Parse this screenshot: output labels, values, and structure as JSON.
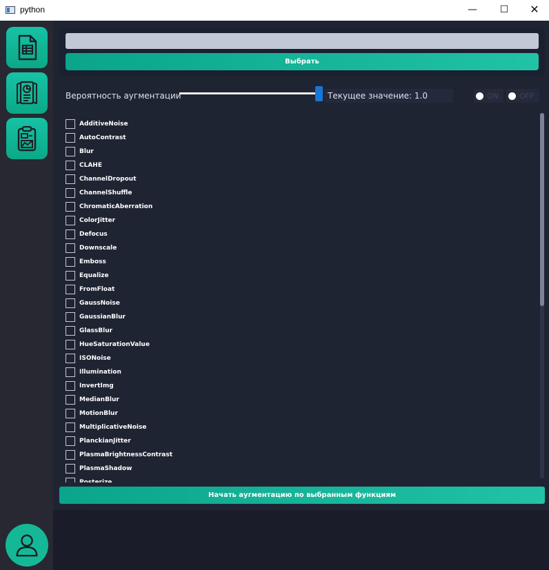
{
  "window": {
    "title": "python",
    "minimize_glyph": "—",
    "maximize_glyph": "☐",
    "close_glyph": "✕"
  },
  "sidebar": {
    "items": [
      {
        "icon": "table-document-icon"
      },
      {
        "icon": "report-chart-icon"
      },
      {
        "icon": "clipboard-chart-icon"
      }
    ],
    "profile_icon": "user-icon",
    "accent": "#14b896"
  },
  "path": {
    "value": "",
    "select_label": "Выбрать"
  },
  "probability": {
    "label": "Вероятность аугментации",
    "slider_value": 1.0,
    "current_label": "Текущее значение: 1.0",
    "on_label": "ON",
    "off_label": "OFF"
  },
  "augmentations": [
    "AdditiveNoise",
    "AutoContrast",
    "Blur",
    "CLAHE",
    "ChannelDropout",
    "ChannelShuffle",
    "ChromaticAberration",
    "ColorJitter",
    "Defocus",
    "Downscale",
    "Emboss",
    "Equalize",
    "FromFloat",
    "GaussNoise",
    "GaussianBlur",
    "GlassBlur",
    "HueSaturationValue",
    "ISONoise",
    "Illumination",
    "InvertImg",
    "MedianBlur",
    "MotionBlur",
    "MultiplicativeNoise",
    "PlanckianJitter",
    "PlasmaBrightnessContrast",
    "PlasmaShadow",
    "Posterize"
  ],
  "start_label": "Начать аугментацию по выбранным функциям",
  "colors": {
    "accent": "#15b896",
    "background": "#1b1c29",
    "panel": "#1f2433",
    "slider_handle": "#1976d2"
  }
}
